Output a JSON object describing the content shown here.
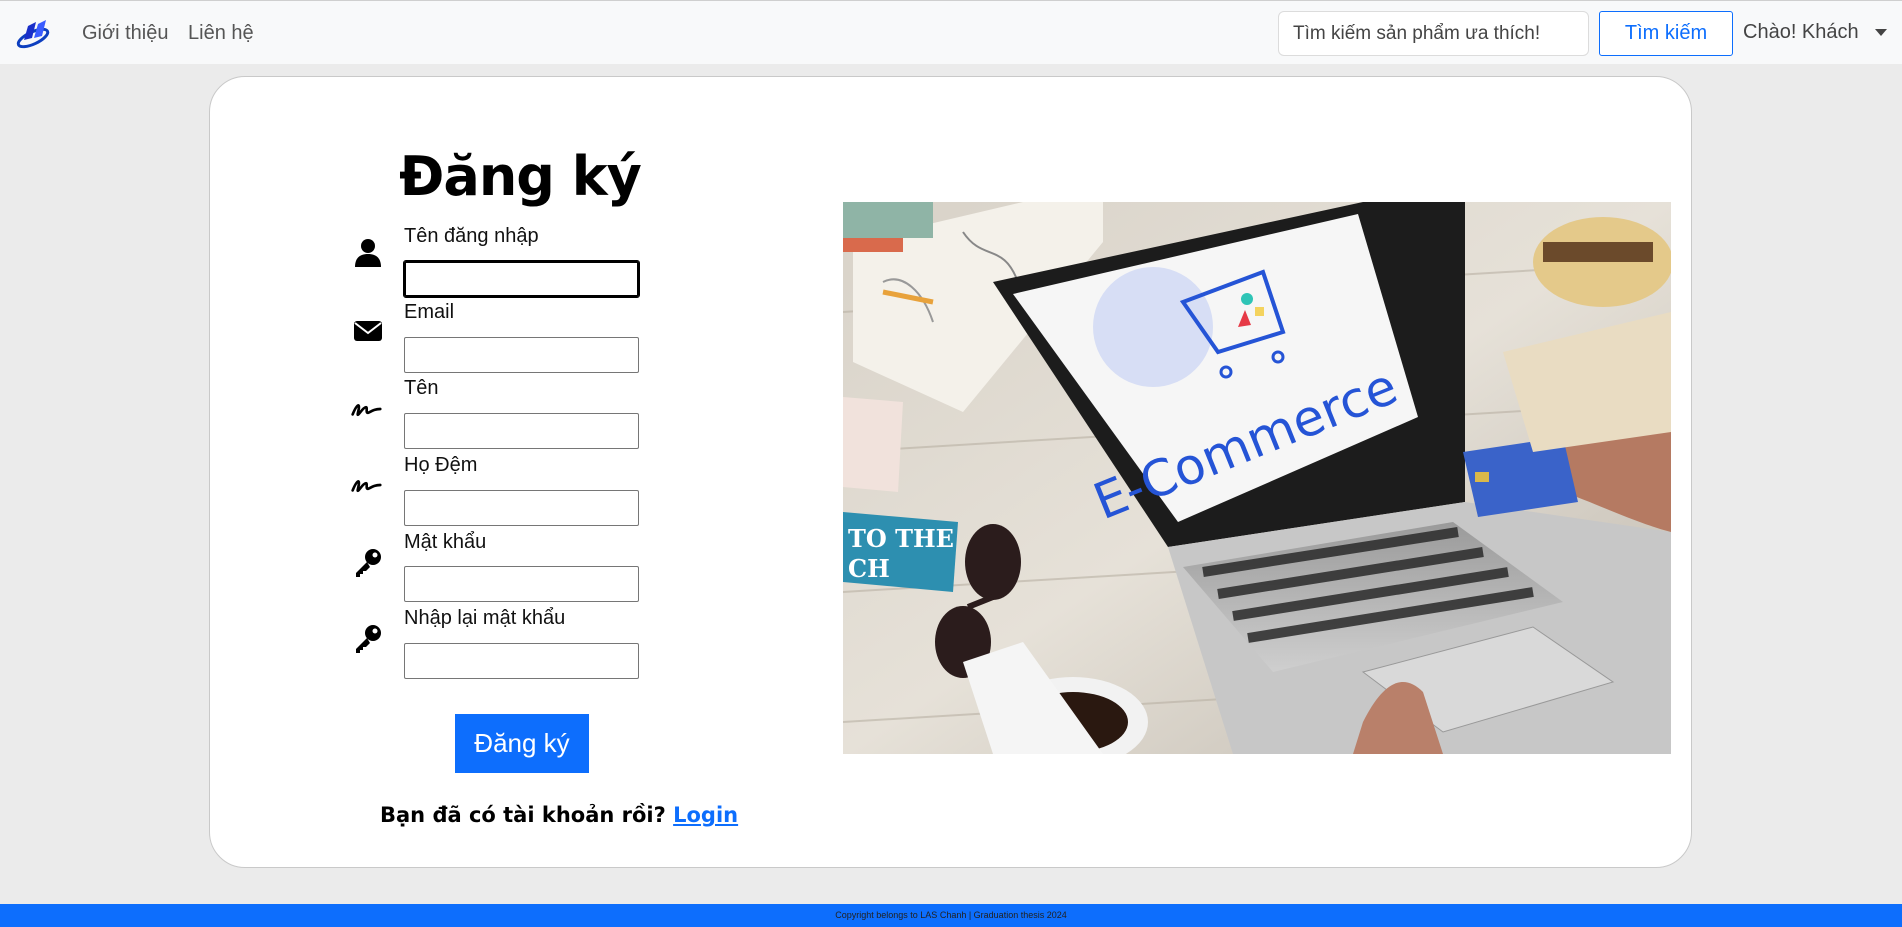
{
  "nav": {
    "about": "Giới thiệu",
    "contact": "Liên hệ",
    "search_placeholder": "Tìm kiếm sản phẩm ưa thích!",
    "search_button": "Tìm kiếm",
    "greeting": "Chào! Khách"
  },
  "form": {
    "title": "Đăng ký",
    "fields": [
      {
        "label": "Tên đăng nhập",
        "icon": "user-icon"
      },
      {
        "label": "Email",
        "icon": "envelope-icon"
      },
      {
        "label": "Tên",
        "icon": "signature-icon"
      },
      {
        "label": "Họ Đệm",
        "icon": "signature-icon"
      },
      {
        "label": "Mật khẩu",
        "icon": "key-icon"
      },
      {
        "label": "Nhập lại mật khẩu",
        "icon": "key-icon"
      }
    ],
    "submit": "Đăng ký",
    "have_account": "Bạn đã có tài khoản rồi?",
    "login_link": "Login"
  },
  "hero": {
    "screen_text": "E-Commerce"
  },
  "footer": {
    "copyright": "Copyright belongs to LAS Chanh | Graduation thesis 2024"
  },
  "colors": {
    "primary": "#0d6efd",
    "page_bg": "#ebebeb",
    "navbar_bg": "#f8f9fa"
  }
}
